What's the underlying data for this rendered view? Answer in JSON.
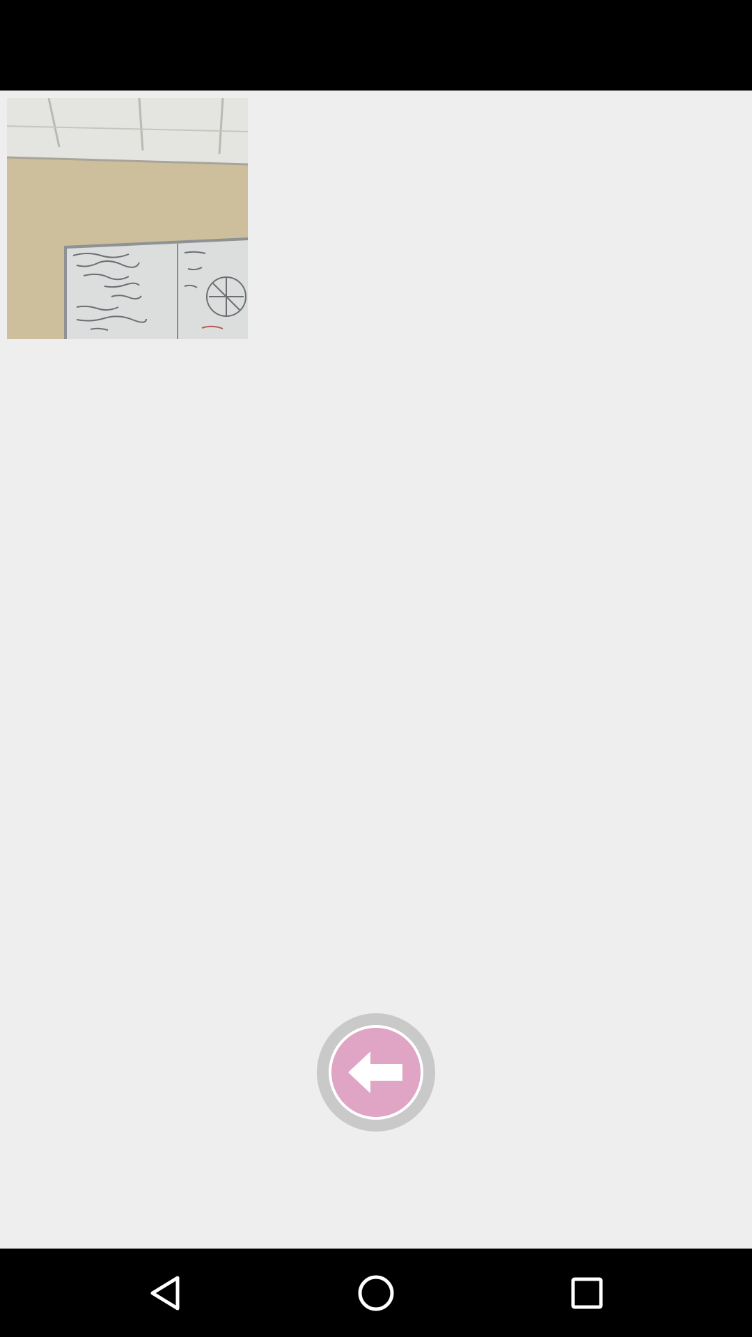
{
  "screen": {
    "colors": {
      "background": "#eeeeee",
      "system_bars": "#000000",
      "fab_ring": "#c9c9c9",
      "fab_fill": "#e0a4c4",
      "icon": "#ffffff"
    }
  },
  "photo": {
    "icon": "photo-thumbnail"
  },
  "back_button": {
    "icon": "arrow-left-icon"
  },
  "nav_bar": {
    "back_icon": "triangle-back-icon",
    "home_icon": "circle-home-icon",
    "recents_icon": "square-recents-icon"
  }
}
